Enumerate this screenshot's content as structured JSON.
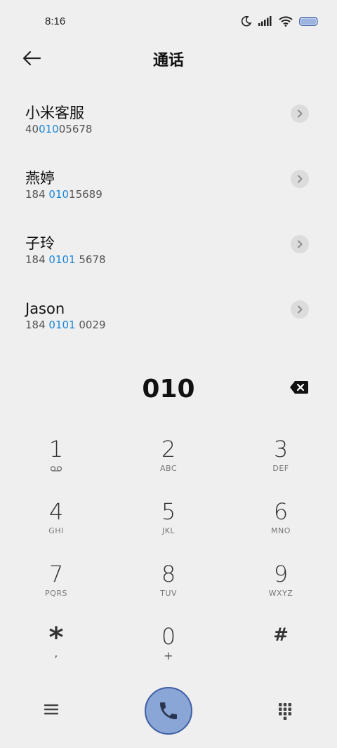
{
  "status": {
    "time": "8:16",
    "icons": [
      "moon-icon",
      "signal-icon",
      "wifi-icon",
      "battery-icon"
    ]
  },
  "header": {
    "title": "通话",
    "back_icon": "arrow-left-icon"
  },
  "contacts": [
    {
      "name": "小米客服",
      "number_pre": "40",
      "number_match": "010",
      "number_post": "05678"
    },
    {
      "name": "燕婷",
      "number_pre": "184 ",
      "number_match": "010",
      "number_post": "15689"
    },
    {
      "name": "子玲",
      "number_pre": "184 ",
      "number_match": "0101",
      "number_post": " 5678"
    },
    {
      "name": "Jason",
      "number_pre": "184 ",
      "number_match": "0101",
      "number_post": " 0029"
    }
  ],
  "dialer": {
    "number": "010",
    "keys": [
      {
        "digit": "1",
        "letters": ""
      },
      {
        "digit": "2",
        "letters": "ABC"
      },
      {
        "digit": "3",
        "letters": "DEF"
      },
      {
        "digit": "4",
        "letters": "GHI"
      },
      {
        "digit": "5",
        "letters": "JKL"
      },
      {
        "digit": "6",
        "letters": "MNO"
      },
      {
        "digit": "7",
        "letters": "PQRS"
      },
      {
        "digit": "8",
        "letters": "TUV"
      },
      {
        "digit": "9",
        "letters": "WXYZ"
      },
      {
        "digit": "*",
        "letters": ","
      },
      {
        "digit": "0",
        "letters": "+"
      },
      {
        "digit": "#",
        "letters": ""
      }
    ]
  },
  "colors": {
    "background": "#efefef",
    "highlight": "#1a86d6",
    "call_button": "#8aa6d6"
  }
}
